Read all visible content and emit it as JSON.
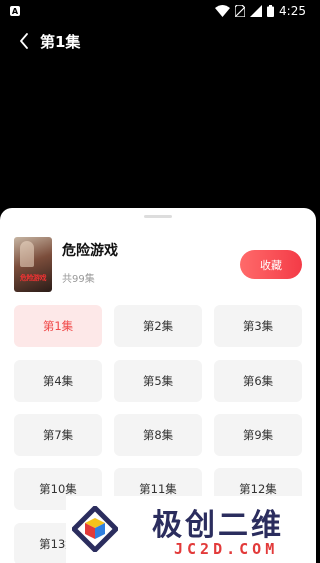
{
  "status_bar": {
    "notification_letter": "A",
    "time": "4:25",
    "icons": [
      "wifi-icon",
      "no-sim-icon",
      "signal-icon",
      "battery-icon"
    ]
  },
  "header": {
    "title": "第1集",
    "back_icon": "chevron-left-icon"
  },
  "sheet": {
    "book_title": "危险游戏",
    "cover_text": "危险游戏",
    "episode_count": "共99集",
    "collect_label": "收藏",
    "episodes": [
      {
        "label": "第1集",
        "active": true
      },
      {
        "label": "第2集",
        "active": false
      },
      {
        "label": "第3集",
        "active": false
      },
      {
        "label": "第4集",
        "active": false
      },
      {
        "label": "第5集",
        "active": false
      },
      {
        "label": "第6集",
        "active": false
      },
      {
        "label": "第7集",
        "active": false
      },
      {
        "label": "第8集",
        "active": false
      },
      {
        "label": "第9集",
        "active": false
      },
      {
        "label": "第10集",
        "active": false
      },
      {
        "label": "第11集",
        "active": false
      },
      {
        "label": "第12集",
        "active": false
      },
      {
        "label": "第13集",
        "active": false
      }
    ]
  },
  "watermark": {
    "chinese": "极创二维",
    "english": "JC2D.COM"
  },
  "colors": {
    "accent": "#f43b47",
    "active_bg": "#fde8e8",
    "active_text": "#f04848",
    "tile_bg": "#f4f4f4"
  }
}
